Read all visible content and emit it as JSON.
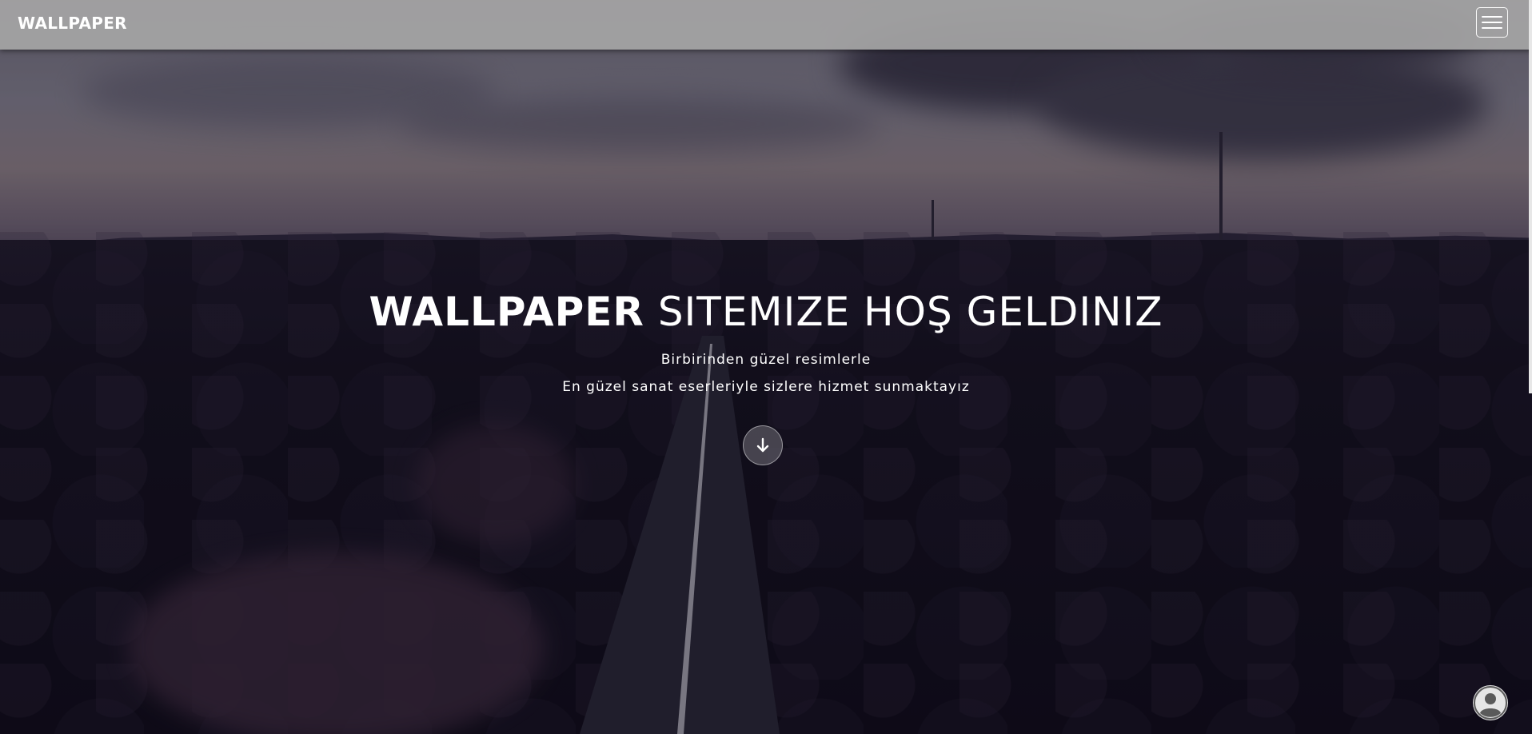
{
  "navbar": {
    "brand": "WALLPAPER",
    "menu_icon": "hamburger-menu-icon"
  },
  "hero": {
    "title_strong": "WALLPAPER",
    "title_rest": "SITEMIZE HOŞ GELDINIZ",
    "subtitle_line1": "Birbirinden güzel resimlerle",
    "subtitle_line2": "En güzel sanat eserleriyle sizlere hizmet sunmaktayız",
    "scroll_icon": "arrow-down-icon"
  },
  "user_button": {
    "icon": "user-avatar-icon"
  },
  "colors": {
    "navbar_bg": "#a5a5a5",
    "text": "#ffffff",
    "background_dark": "#0b0a14"
  }
}
